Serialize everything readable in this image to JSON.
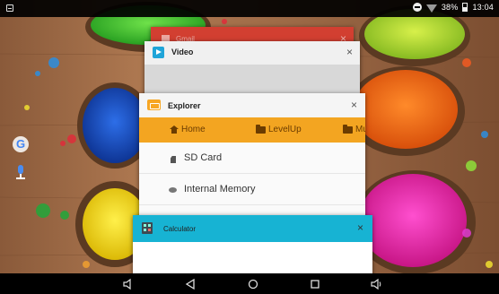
{
  "status_bar": {
    "battery": "38%",
    "time": "13:04"
  },
  "recent_apps": [
    {
      "title": "Gmail"
    },
    {
      "title": "Video"
    },
    {
      "title": "Explorer",
      "tabs": [
        "Home",
        "LevelUp",
        "Mu"
      ],
      "items": [
        "SD Card",
        "Internal Memory"
      ]
    },
    {
      "title": "Calculator"
    }
  ],
  "colors": {
    "gmail_header": "#d23f31",
    "explorer_accent": "#f3a521",
    "calculator_header": "#17b3d3",
    "video_icon": "#1fa4d8"
  },
  "icons": {
    "close": "×",
    "side_shortcuts": [
      "google-search-icon",
      "voice-search-icon"
    ],
    "nav": [
      "volume-down-icon",
      "back-icon",
      "home-icon",
      "recents-icon",
      "volume-up-icon"
    ]
  }
}
